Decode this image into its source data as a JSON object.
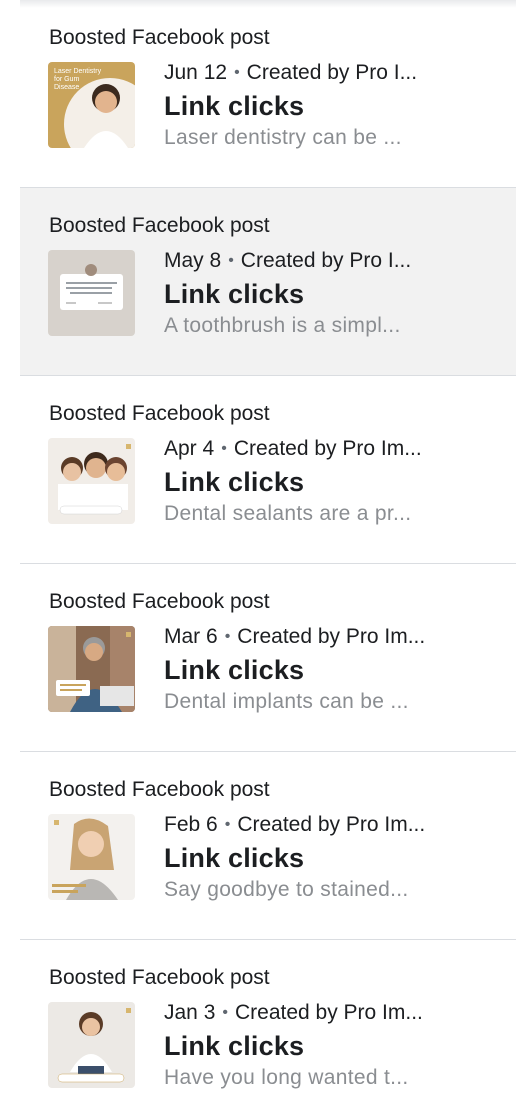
{
  "posts": [
    {
      "type": "Boosted Facebook post",
      "date": "Jun 12",
      "creator": "Created by Pro I...",
      "objective": "Link clicks",
      "preview": "Laser dentistry can be ...",
      "thumb_text": "Laser Dentistry for Gum Disease",
      "thumb_color": "#c9a45c"
    },
    {
      "type": "Boosted Facebook post",
      "date": "May 8",
      "creator": "Created by Pro I...",
      "objective": "Link clicks",
      "preview": "A toothbrush is a simpl...",
      "thumb_color": "#d7d2cc"
    },
    {
      "type": "Boosted Facebook post",
      "date": "Apr 4",
      "creator": "Created by Pro Im...",
      "objective": "Link clicks",
      "preview": "Dental sealants are a pr...",
      "thumb_color": "#f1ede8"
    },
    {
      "type": "Boosted Facebook post",
      "date": "Mar 6",
      "creator": "Created by Pro Im...",
      "objective": "Link clicks",
      "preview": "Dental implants can be ...",
      "thumb_color": "#8a6a52"
    },
    {
      "type": "Boosted Facebook post",
      "date": "Feb 6",
      "creator": "Created by Pro Im...",
      "objective": "Link clicks",
      "preview": "Say goodbye to stained...",
      "thumb_color": "#f3f1ee"
    },
    {
      "type": "Boosted Facebook post",
      "date": "Jan 3",
      "creator": "Created by Pro Im...",
      "objective": "Link clicks",
      "preview": "Have you long wanted t...",
      "thumb_color": "#ece9e5"
    }
  ],
  "separator": "•"
}
